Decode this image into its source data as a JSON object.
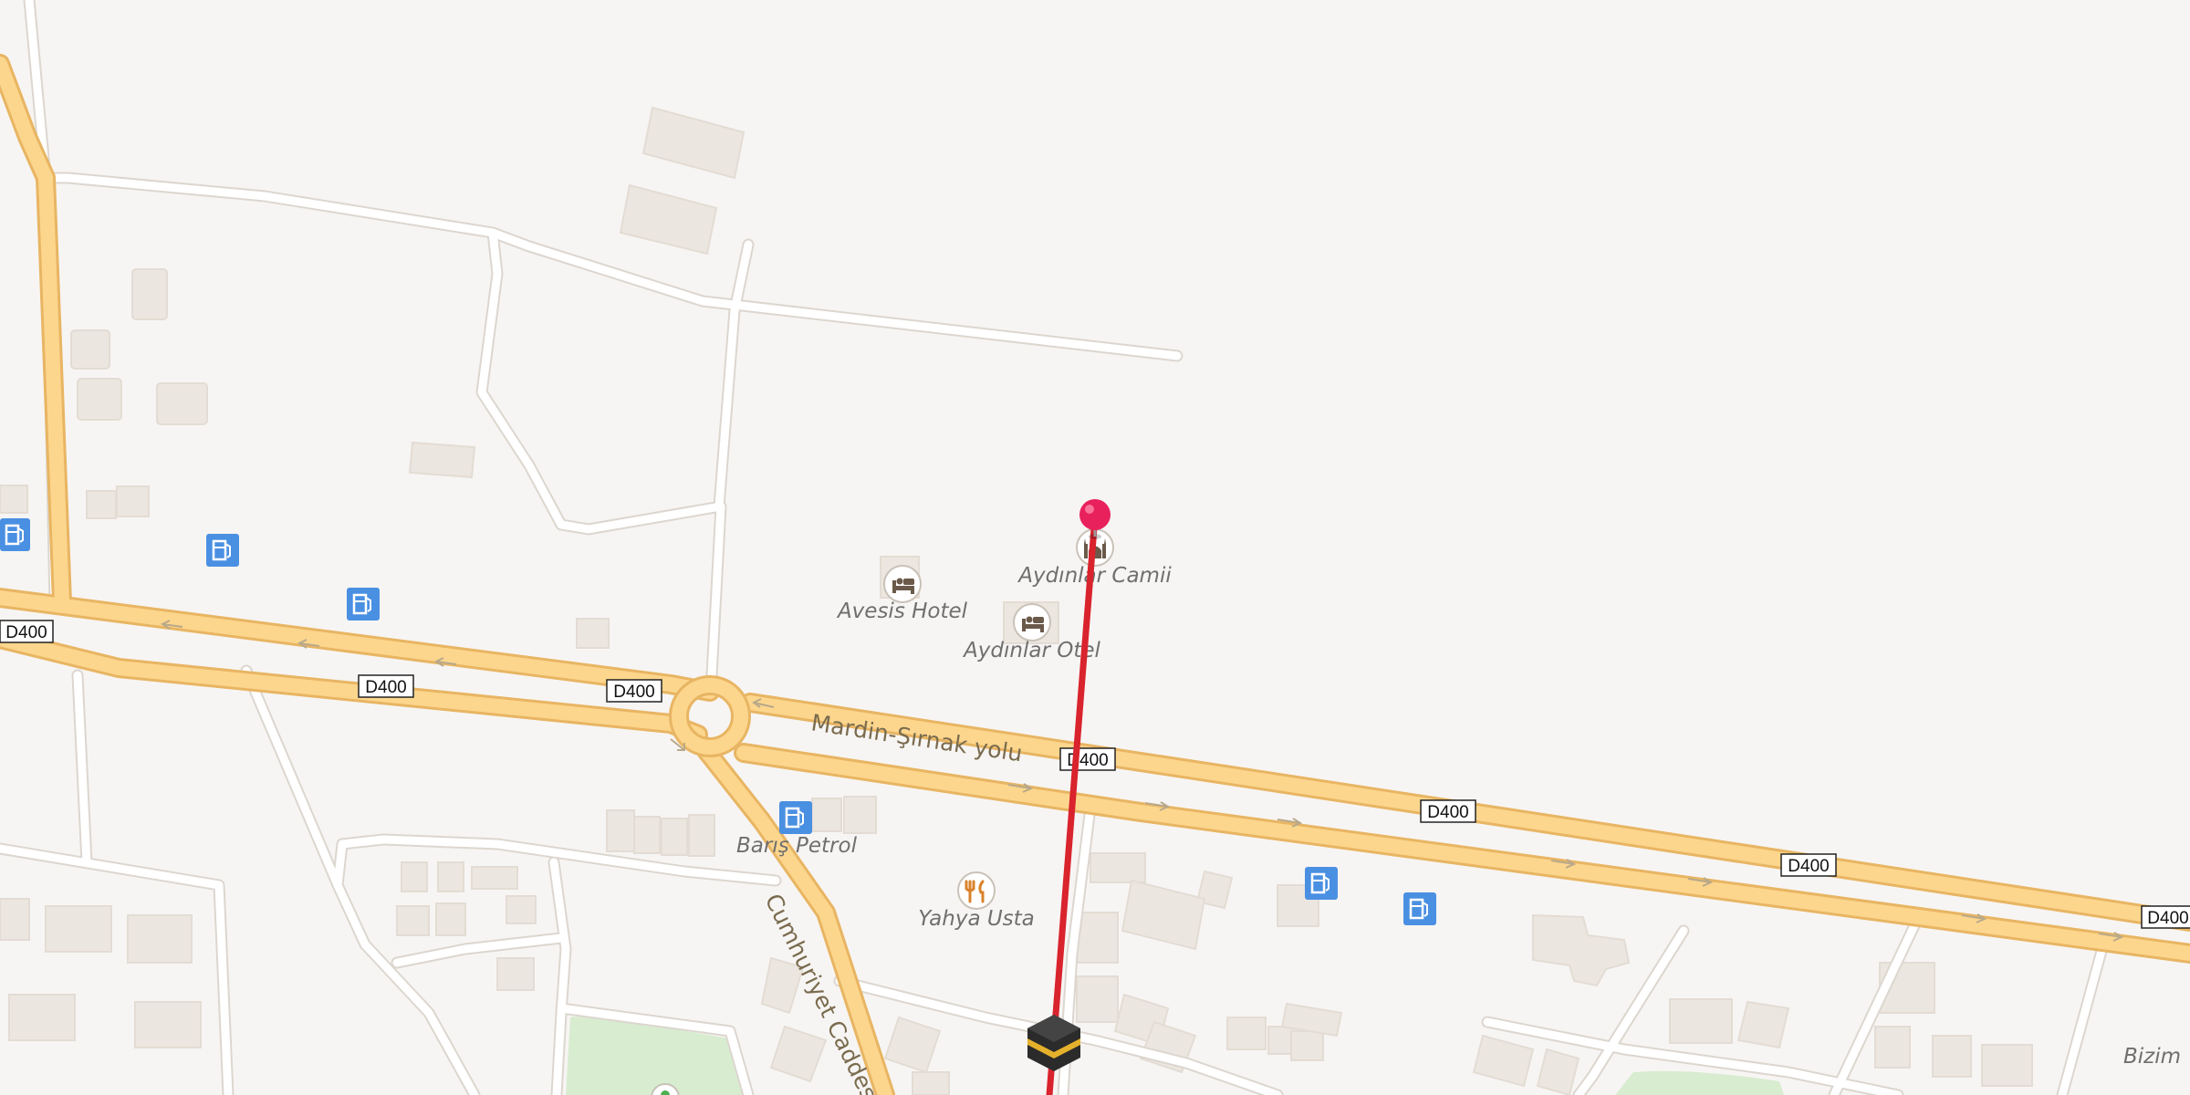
{
  "map": {
    "road_labels": {
      "main_highway": "Mardin-Şırnak yolu",
      "side_street": "Cumhuriyet Caddesi"
    },
    "route_shield": "D400",
    "pois": {
      "mosque": "Aydınlar Camii",
      "hotel_1": "Avesis Hotel",
      "hotel_2": "Aydınlar Otel",
      "fuel_station": "Barış Petrol",
      "restaurant": "Yahya Usta"
    },
    "corner_label": "Bizim",
    "icons": {
      "fuel": "fuel-pump-icon",
      "hotel": "bed-icon",
      "mosque": "mosque-icon",
      "restaurant": "fork-knife-icon",
      "destination": "kaaba-icon",
      "pin": "location-pin-icon"
    },
    "colors": {
      "background": "#f7f5f3",
      "highway": "#fcd68d",
      "highway_edge": "#e8b563",
      "minor_road": "#ffffff",
      "building": "#ece6e0",
      "park": "#d8ecd0",
      "fuel_icon": "#4a90e2",
      "route_line": "#d9232d",
      "pin": "#e8215c"
    }
  }
}
